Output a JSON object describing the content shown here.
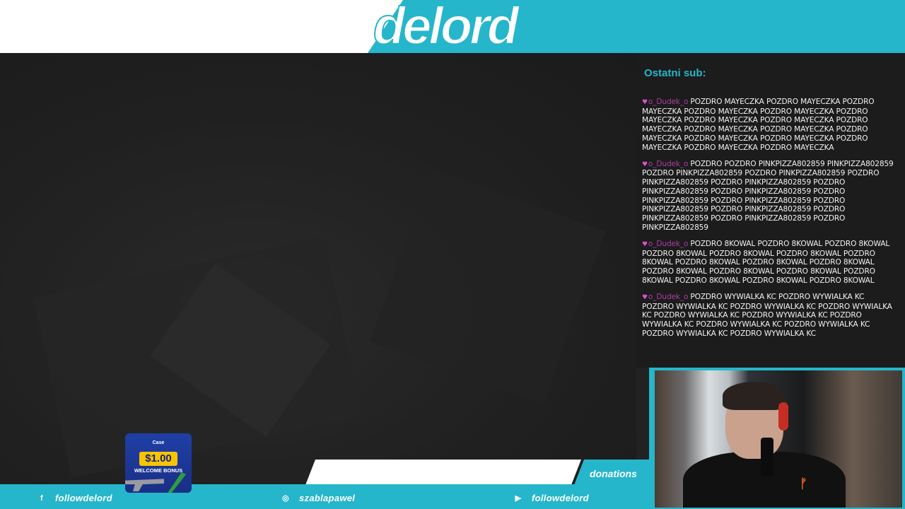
{
  "header": {
    "logo_text": "delord"
  },
  "sub_panel": {
    "title": "Ostatni sub:",
    "messages": [
      {
        "user": "o_Dudek_o",
        "text": "POZDRO MAYECZKA POZDRO MAYECZKA POZDRO MAYECZKA POZDRO MAYECZKA POZDRO MAYECZKA POZDRO MAYECZKA POZDRO MAYECZKA POZDRO MAYECZKA POZDRO MAYECZKA POZDRO MAYECZKA POZDRO MAYECZKA POZDRO MAYECZKA POZDRO MAYECZKA POZDRO MAYECZKA POZDRO MAYECZKA POZDRO MAYECZKA POZDRO MAYECZKA"
      },
      {
        "user": "o_Dudek_o",
        "text": "POZDRO POZDRO PINKPIZZA802859 PINKPIZZA802859 POZDRO PINKPIZZA802859 POZDRO PINKPIZZA802859 POZDRO PINKPIZZA802859 POZDRO PINKPIZZA802859 POZDRO PINKPIZZA802859 POZDRO PINKPIZZA802859 POZDRO PINKPIZZA802859 POZDRO PINKPIZZA802859 POZDRO PINKPIZZA802859 POZDRO PINKPIZZA802859 POZDRO PINKPIZZA802859 POZDRO PINKPIZZA802859 POZDRO PINKPIZZA802859"
      },
      {
        "user": "o_Dudek_o",
        "text": "POZDRO 8KOWAL POZDRO 8KOWAL POZDRO 8KOWAL POZDRO 8KOWAL POZDRO 8KOWAL POZDRO 8KOWAL POZDRO 8KOWAL POZDRO 8KOWAL POZDRO 8KOWAL POZDRO 8KOWAL POZDRO 8KOWAL POZDRO 8KOWAL POZDRO 8KOWAL POZDRO 8KOWAL POZDRO 8KOWAL POZDRO 8KOWAL POZDRO 8KOWAL"
      },
      {
        "user": "o_Dudek_o",
        "text": "POZDRO WYWIALKA KC POZDRO WYWIALKA KC POZDRO WYWIALKA KC POZDRO WYWIALKA KC POZDRO WYWIALKA KC POZDRO WYWIALKA KC POZDRO WYWIALKA KC POZDRO WYWIALKA KC POZDRO WYWIALKA KC POZDRO WYWIALKA KC POZDRO WYWIALKA KC POZDRO WYWIALKA KC"
      }
    ]
  },
  "donation": {
    "label": "donations"
  },
  "sponsor": {
    "brand": "Case",
    "amount": "$1.00",
    "bonus": "WELCOME BONUS"
  },
  "socials": [
    {
      "icon": "facebook-icon",
      "glyph": "f",
      "handle": "followdelord"
    },
    {
      "icon": "instagram-icon",
      "glyph": "◎",
      "handle": "szablapawel"
    },
    {
      "icon": "youtube-icon",
      "glyph": "▶",
      "handle": "followdelord"
    }
  ],
  "colors": {
    "accent": "#26b6cb",
    "username": "#a93ea3",
    "heart": "#e04fcf",
    "sponsor_bg": "#1f3fa6",
    "sponsor_amount": "#f7c400"
  }
}
